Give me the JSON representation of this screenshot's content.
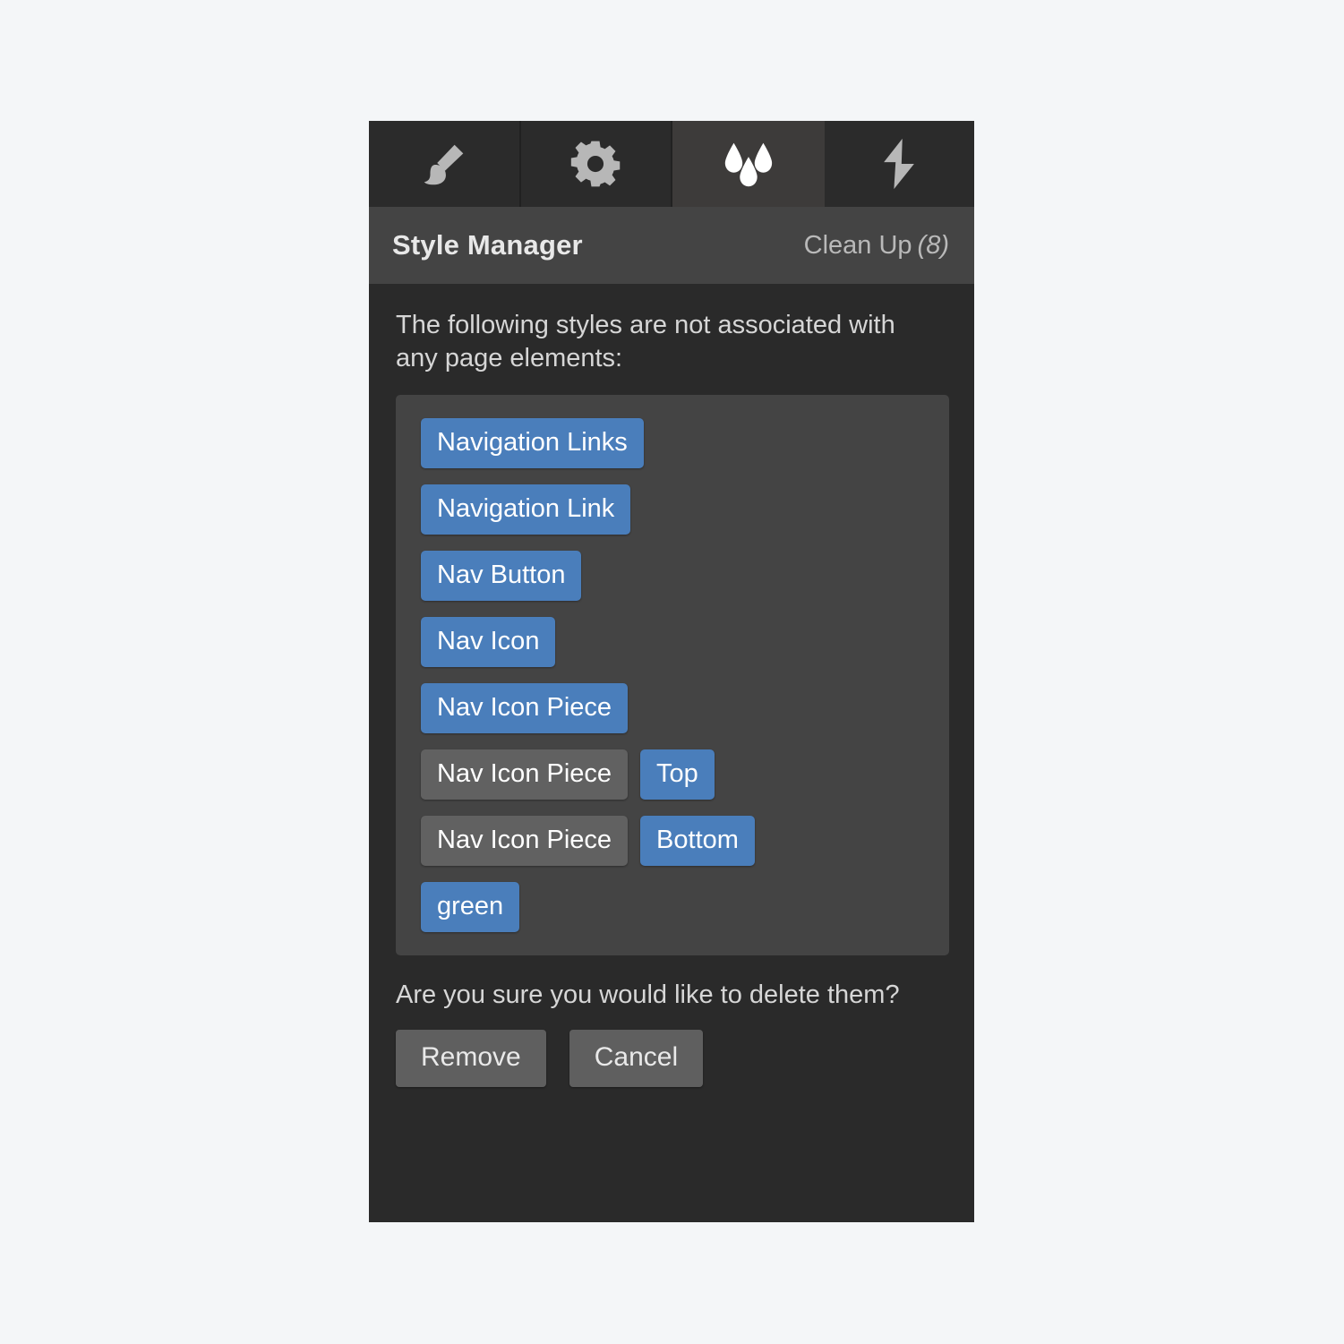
{
  "tabs": [
    {
      "id": "tab-brush",
      "icon": "paint-brush-icon",
      "active": false
    },
    {
      "id": "tab-settings",
      "icon": "gear-icon",
      "active": false
    },
    {
      "id": "tab-styles",
      "icon": "water-drops-icon",
      "active": true
    },
    {
      "id": "tab-interactions",
      "icon": "lightning-bolt-icon",
      "active": false
    }
  ],
  "header": {
    "title": "Style Manager",
    "cleanup_label": "Clean Up",
    "cleanup_count": "(8)"
  },
  "body": {
    "intro_text": "The following styles are not associated with any page elements:",
    "confirm_text": "Are you sure you would like to delete them?"
  },
  "style_list": {
    "rows": [
      {
        "tags": [
          {
            "label": "Navigation Links",
            "color": "blue"
          }
        ]
      },
      {
        "tags": [
          {
            "label": "Navigation Link",
            "color": "blue"
          }
        ]
      },
      {
        "tags": [
          {
            "label": "Nav Button",
            "color": "blue"
          }
        ]
      },
      {
        "tags": [
          {
            "label": "Nav Icon",
            "color": "blue"
          }
        ]
      },
      {
        "tags": [
          {
            "label": "Nav Icon Piece",
            "color": "blue"
          }
        ]
      },
      {
        "tags": [
          {
            "label": "Nav Icon Piece",
            "color": "grey"
          },
          {
            "label": "Top",
            "color": "blue"
          }
        ]
      },
      {
        "tags": [
          {
            "label": "Nav Icon Piece",
            "color": "grey"
          },
          {
            "label": "Bottom",
            "color": "blue"
          }
        ]
      },
      {
        "tags": [
          {
            "label": "green",
            "color": "blue"
          }
        ]
      }
    ]
  },
  "buttons": {
    "remove_label": "Remove",
    "cancel_label": "Cancel"
  },
  "colors": {
    "canvas": "#f4f6f8",
    "panel_bg": "#2a2a2a",
    "header_bg": "#444444",
    "list_bg": "#444444",
    "tab_inactive": "#2b2b2b",
    "tab_active": "#3d3b3a",
    "tag_blue": "#4a7ebb",
    "tag_grey": "#616161",
    "button_bg": "#5f5f5f",
    "text_primary": "#e8e8e8",
    "text_secondary": "#b9b9b9"
  }
}
